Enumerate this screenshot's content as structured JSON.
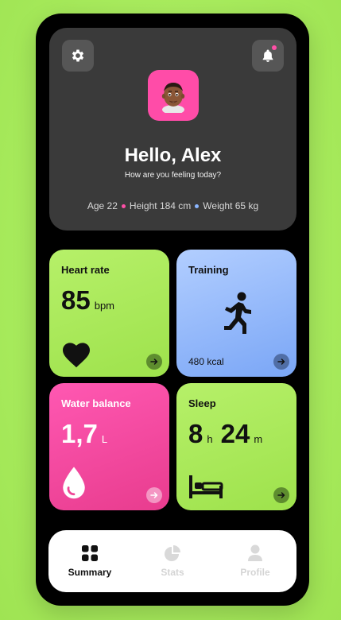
{
  "header": {
    "greeting": "Hello, Alex",
    "subtitle": "How are you feeling today?",
    "age": "Age 22",
    "height": "Height 184 cm",
    "weight": "Weight 65 kg",
    "settings_icon": "gear-icon",
    "notifications_icon": "bell-icon",
    "avatar": "memoji-avatar"
  },
  "tiles": {
    "heart": {
      "title": "Heart rate",
      "value": "85",
      "unit": "bpm",
      "icon": "heart-icon"
    },
    "training": {
      "title": "Training",
      "calories": "480 kcal",
      "icon": "running-icon"
    },
    "water": {
      "title": "Water balance",
      "value": "1,7",
      "unit": "L",
      "icon": "water-drop-icon"
    },
    "sleep": {
      "title": "Sleep",
      "hours": "8",
      "hours_unit": "h",
      "minutes": "24",
      "minutes_unit": "m",
      "icon": "bed-icon"
    }
  },
  "tabs": [
    {
      "label": "Summary",
      "icon": "grid-icon",
      "active": true
    },
    {
      "label": "Stats",
      "icon": "pie-chart-icon",
      "active": false
    },
    {
      "label": "Profile",
      "icon": "person-icon",
      "active": false
    }
  ],
  "colors": {
    "background": "#a9ec5e",
    "accent_pink": "#ff4ca8",
    "accent_green": "#a8e85a",
    "accent_blue": "#8ab2fb",
    "card_dark": "#3a3a3a"
  }
}
